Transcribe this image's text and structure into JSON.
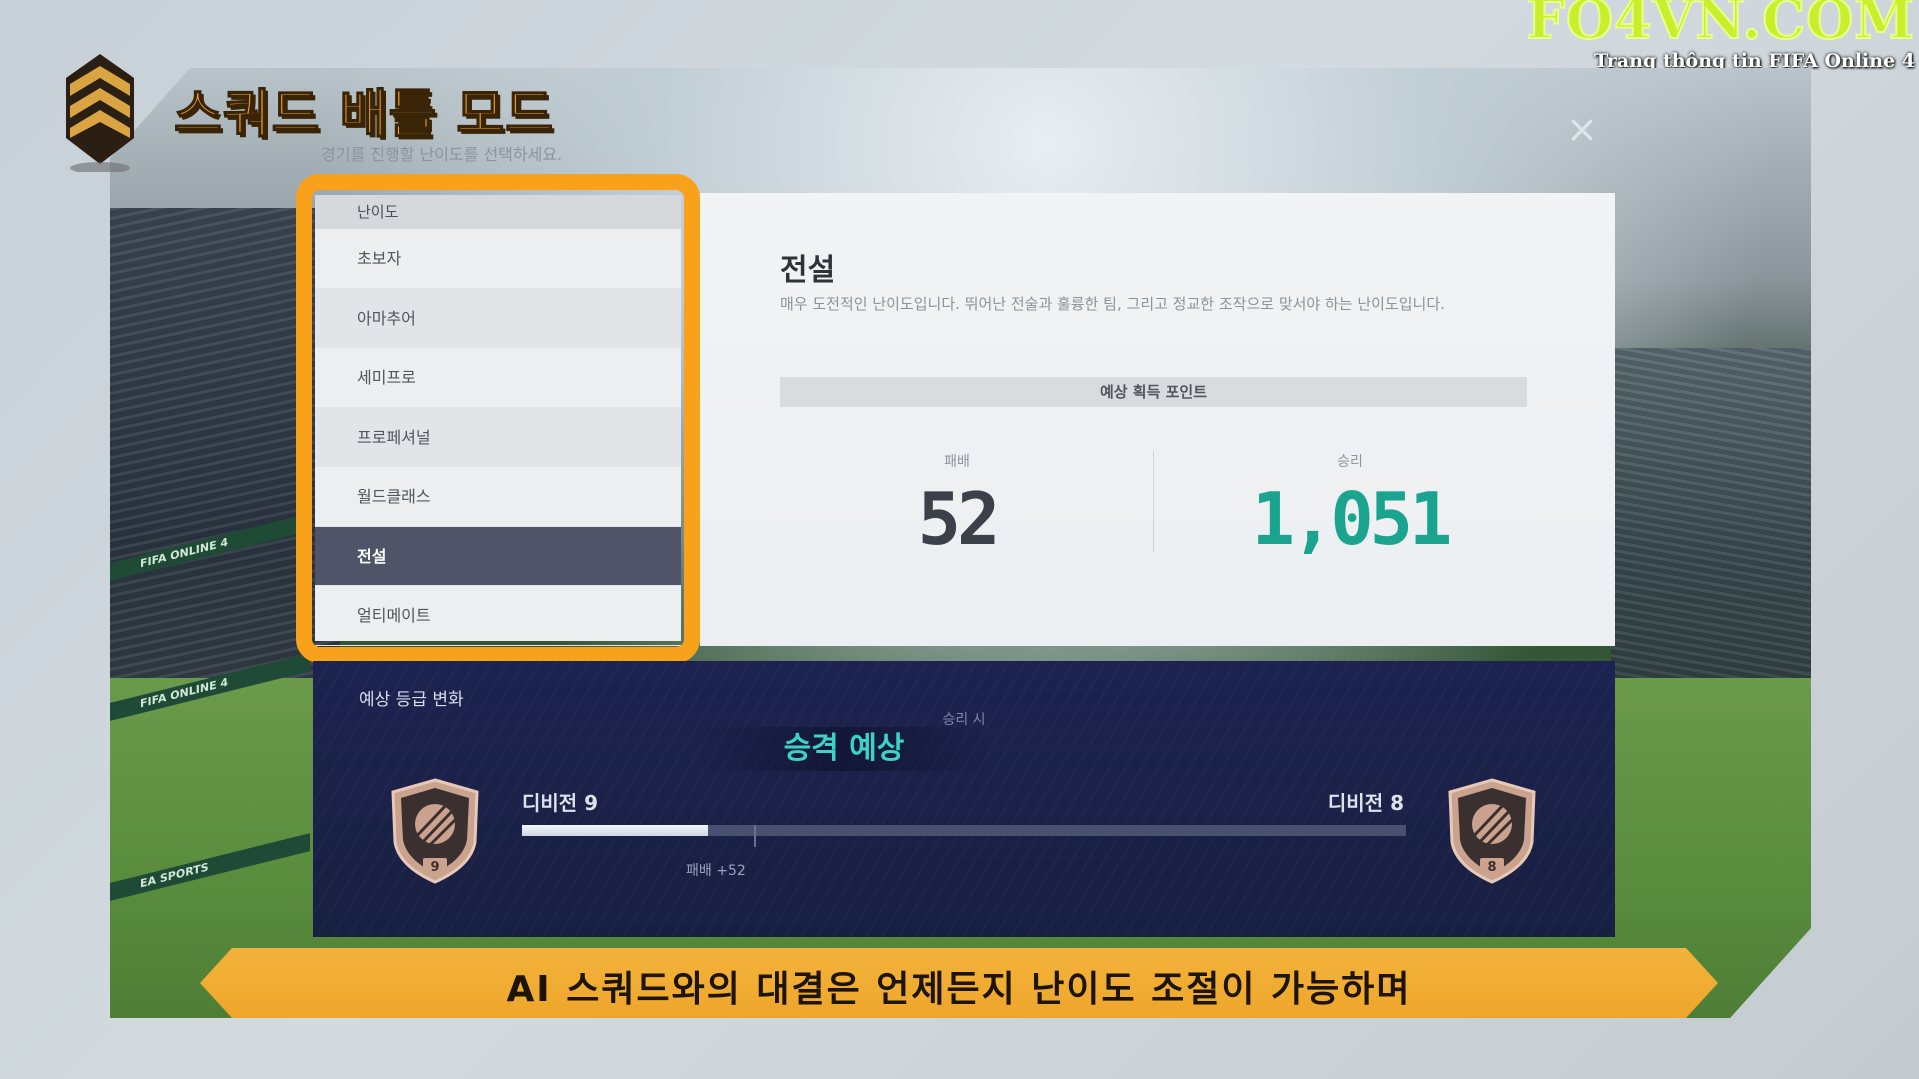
{
  "watermark": {
    "logo": "FO4VN.COM",
    "tagline": "Trang thông tin FIFA Online 4"
  },
  "header": {
    "title": "스쿼드 배틀 모드",
    "subtitle": "경기를 진행할 난이도를 선택하세요.",
    "close_icon": "close-icon"
  },
  "difficulty": {
    "header": "난이도",
    "items": [
      {
        "label": "초보자",
        "selected": false
      },
      {
        "label": "아마추어",
        "selected": false
      },
      {
        "label": "세미프로",
        "selected": false
      },
      {
        "label": "프로페셔널",
        "selected": false
      },
      {
        "label": "월드클래스",
        "selected": false
      },
      {
        "label": "전설",
        "selected": true
      },
      {
        "label": "얼티메이트",
        "selected": false
      }
    ]
  },
  "detail": {
    "title": "전설",
    "description": "매우 도전적인 난이도입니다. 뛰어난 전술과 훌륭한 팀, 그리고 정교한 조작으로 맞서야 하는 난이도입니다.",
    "points_header": "예상 획득 포인트",
    "loss_label": "패배",
    "loss_points": "52",
    "win_label": "승리",
    "win_points": "1,051"
  },
  "grade_change": {
    "title": "예상 등급 변화",
    "win_caption": "승리 시",
    "result": "승격 예상",
    "current_division": "디비전 9",
    "next_division": "디비전 8",
    "current_badge_number": "9",
    "next_badge_number": "8",
    "progress_fraction": 0.21,
    "loss_marker": "패배 +52"
  },
  "caption": "AI 스쿼드와의 대결은 언제든지 난이도 조절이 가능하며",
  "colors": {
    "accent_orange": "#f7a21a",
    "win_green": "#1aa38f",
    "loss_dark": "#3c4149",
    "panel_navy": "#1c2350",
    "selected_row": "#4f5468",
    "promo_teal": "#3ad3c6"
  }
}
